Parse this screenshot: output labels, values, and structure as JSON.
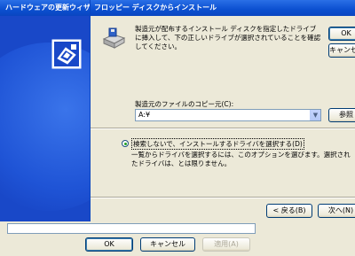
{
  "back_window": {
    "title": "ハードウェアの更新ウィザード",
    "buttons": {
      "ok": "OK",
      "cancel": "キャンセル",
      "apply": "適用(A)"
    }
  },
  "dialog": {
    "title": "フロッピー ディスクからインストール",
    "intro": "製造元が配布するインストール ディスクを指定したドライブに挿入して、下の正しいドライブが選択されていることを確認してください。",
    "buttons": {
      "ok": "OK",
      "cancel": "キャンセル",
      "browse": "参照"
    },
    "source_label": "製造元のファイルのコピー元(C):",
    "source_value": "A:¥",
    "radio_label": "検索しないで、インストールするドライバを選択する(D)",
    "radio_description": "一覧からドライバを選択するには、このオプションを選びます。選択されたドライバは、とは限りません。",
    "nav": {
      "back": "< 戻る(B)",
      "next": "次へ(N)"
    }
  },
  "colors": {
    "title_bar": "#0b4fd0",
    "dialog_bg": "#ece9d8",
    "banner": "#1948c8"
  }
}
